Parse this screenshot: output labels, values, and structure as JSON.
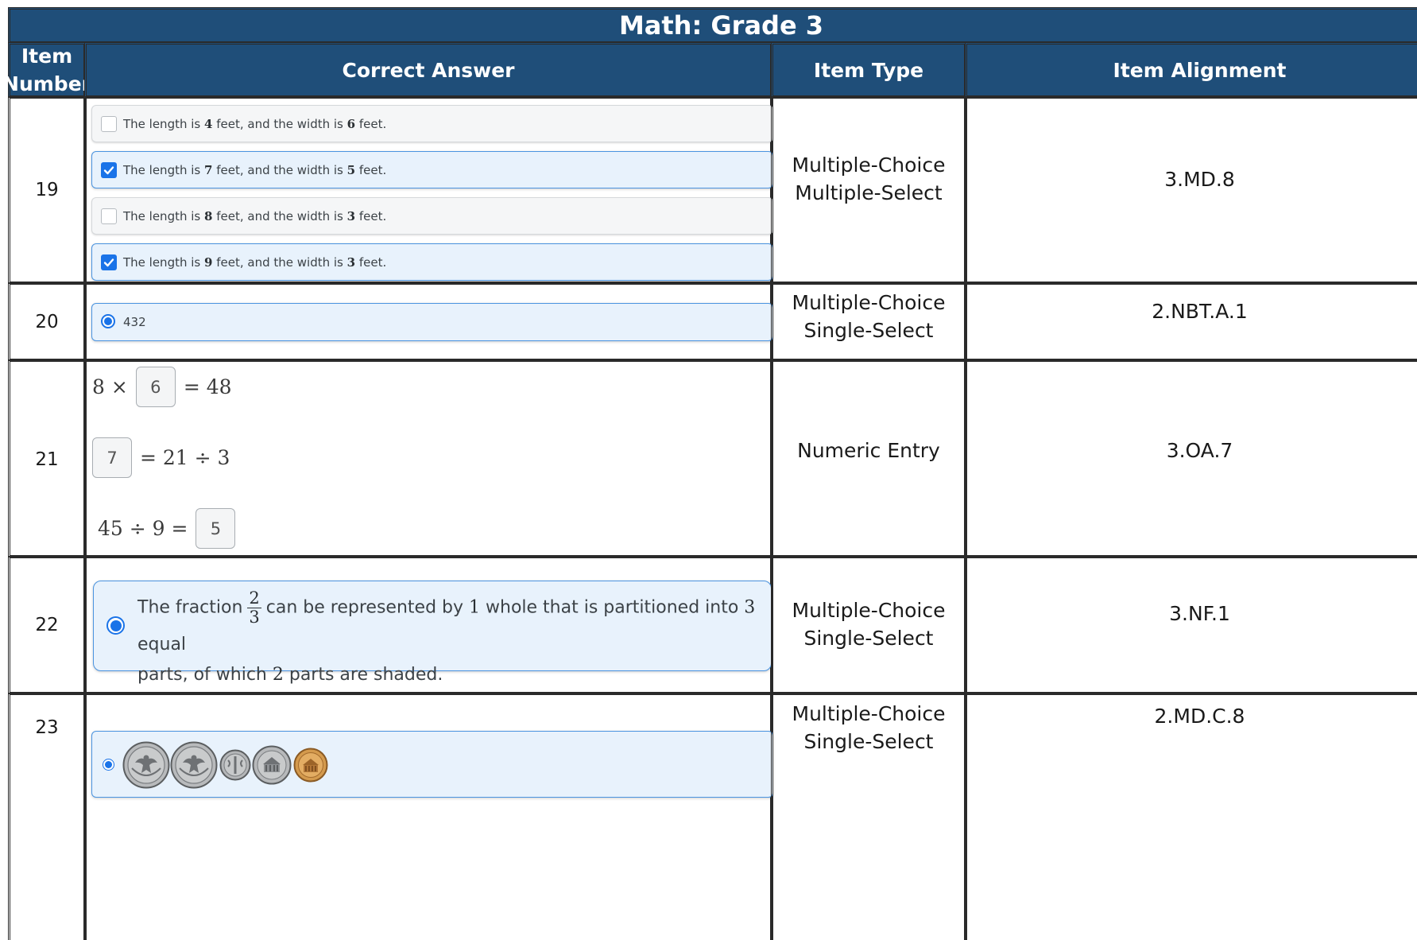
{
  "title": "Math: Grade 3",
  "headers": {
    "item_number_line1": "Item",
    "item_number_line2": "Number",
    "correct_answer": "Correct Answer",
    "item_type": "Item Type",
    "item_alignment": "Item Alignment"
  },
  "rows": [
    {
      "number": "19",
      "type_line1": "Multiple-Choice",
      "type_line2": "Multiple-Select",
      "alignment": "3.MD.8",
      "choices": [
        {
          "prefix": "The length is",
          "length": "4",
          "mid": "feet, and the width is",
          "width": "6",
          "suffix": "feet.",
          "checked": false
        },
        {
          "prefix": "The length is",
          "length": "7",
          "mid": "feet, and the width is",
          "width": "5",
          "suffix": "feet.",
          "checked": true
        },
        {
          "prefix": "The length is",
          "length": "8",
          "mid": "feet, and the width is",
          "width": "3",
          "suffix": "feet.",
          "checked": false
        },
        {
          "prefix": "The length is",
          "length": "9",
          "mid": "feet, and the width is",
          "width": "3",
          "suffix": "feet.",
          "checked": true
        }
      ]
    },
    {
      "number": "20",
      "type_line1": "Multiple-Choice",
      "type_line2": "Single-Select",
      "alignment": "2.NBT.A.1",
      "answer": "432"
    },
    {
      "number": "21",
      "type": "Numeric Entry",
      "alignment": "3.OA.7",
      "eq1": {
        "left": "8 ×",
        "box": "6",
        "right": "= 48"
      },
      "eq2": {
        "box": "7",
        "right": "= 21 ÷ 3"
      },
      "eq3": {
        "left": "45 ÷ 9 =",
        "box": "5"
      }
    },
    {
      "number": "22",
      "type_line1": "Multiple-Choice",
      "type_line2": "Single-Select",
      "alignment": "3.NF.1",
      "answer": {
        "pre": "The fraction",
        "numerator": "2",
        "denominator": "3",
        "post": "can be represented by",
        "whole": "1",
        "post2": "whole that is partitioned into",
        "parts": "3",
        "post3": "equal",
        "line2_pre": "parts, of which",
        "shaded": "2",
        "line2_post": "parts are shaded."
      }
    },
    {
      "number": "23",
      "type_line1": "Multiple-Choice",
      "type_line2": "Single-Select",
      "alignment": "2.MD.C.8",
      "coins": [
        "quarter",
        "quarter",
        "dime",
        "nickel",
        "penny"
      ]
    }
  ],
  "colors": {
    "header_bg": "#1f4e79",
    "header_text": "#ffffff",
    "selected_bg": "#e8f2fc",
    "selected_border": "#4b94e0",
    "control_blue": "#1a73e8"
  }
}
